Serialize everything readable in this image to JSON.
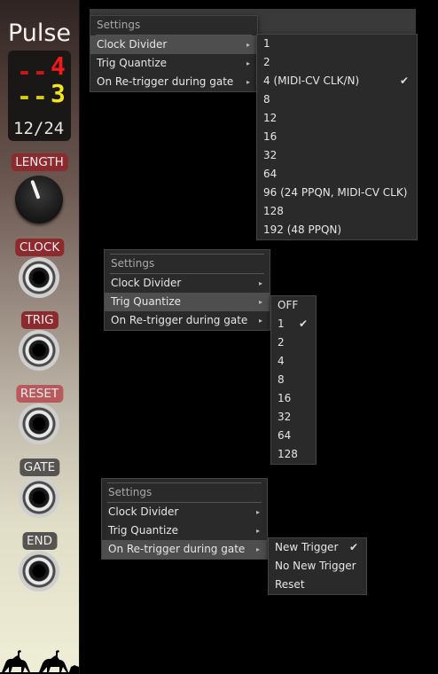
{
  "module": {
    "title": "Pulse",
    "display": {
      "top_dashes": "--",
      "top_value": "4",
      "bottom_dashes": "--",
      "bottom_value": "3",
      "ratio": "12/24"
    },
    "labels": {
      "length": "LENGTH",
      "clock": "CLOCK",
      "trig": "TRIG",
      "reset": "RESET",
      "gate": "GATE",
      "end": "END"
    }
  },
  "menu1": {
    "header": "Settings",
    "items": [
      "Clock Divider",
      "Trig Quantize",
      "On Re-trigger during gate"
    ],
    "submenu": [
      "1",
      "2",
      "4 (MIDI-CV CLK/N)",
      "8",
      "12",
      "16",
      "32",
      "64",
      "96 (24 PPQN, MIDI-CV CLK)",
      "128",
      "192 (48 PPQN)"
    ],
    "checked": "4 (MIDI-CV CLK/N)"
  },
  "menu2": {
    "header": "Settings",
    "items": [
      "Clock Divider",
      "Trig Quantize",
      "On Re-trigger during gate"
    ],
    "submenu": [
      "OFF",
      "1",
      "2",
      "4",
      "8",
      "16",
      "32",
      "64",
      "128"
    ],
    "checked": "1"
  },
  "menu3": {
    "header": "Settings",
    "items": [
      "Clock Divider",
      "Trig Quantize",
      "On Re-trigger during gate"
    ],
    "submenu": [
      "New Trigger",
      "No New Trigger",
      "Reset"
    ],
    "checked": "New Trigger"
  },
  "glyphs": {
    "arrow": "▸",
    "check": "✔"
  },
  "colors": {
    "menu_bg": "#2a2a2a",
    "menu_highlight": "#4e4e4e",
    "label_red": "#8c2a2e",
    "display_red": "#f01a1a",
    "display_yellow": "#f2e61a"
  }
}
